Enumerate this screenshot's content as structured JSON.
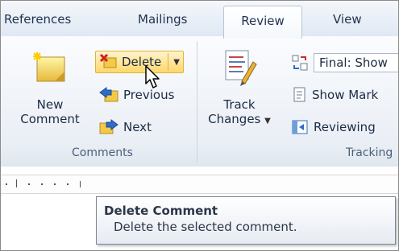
{
  "tabs": [
    {
      "label": "References"
    },
    {
      "label": "Mailings"
    },
    {
      "label": "Review",
      "active": true
    },
    {
      "label": "View"
    }
  ],
  "comments_group": {
    "label": "Comments",
    "new_comment_line1": "New",
    "new_comment_line2": "Comment",
    "delete_label": "Delete",
    "previous_label": "Previous",
    "next_label": "Next"
  },
  "tracking_group": {
    "label": "Tracking",
    "track_changes_line1": "Track",
    "track_changes_line2": "Changes",
    "final_show_label": "Final: Show",
    "show_markup_label": "Show Mark",
    "reviewing_label": "Reviewing"
  },
  "tooltip": {
    "title": "Delete Comment",
    "description": "Delete the selected comment."
  },
  "icons": {
    "new_comment": "new-comment-icon",
    "delete": "delete-comment-icon",
    "previous": "previous-comment-icon",
    "next": "next-comment-icon",
    "track_changes": "track-changes-icon",
    "final_show": "display-for-review-icon",
    "show_markup": "show-markup-icon",
    "reviewing": "reviewing-pane-icon",
    "cursor": "mouse-pointer-icon"
  },
  "colors": {
    "ribbon_bg": "#e9eef5",
    "highlight": "#ffd76b",
    "text": "#1b2c44"
  }
}
